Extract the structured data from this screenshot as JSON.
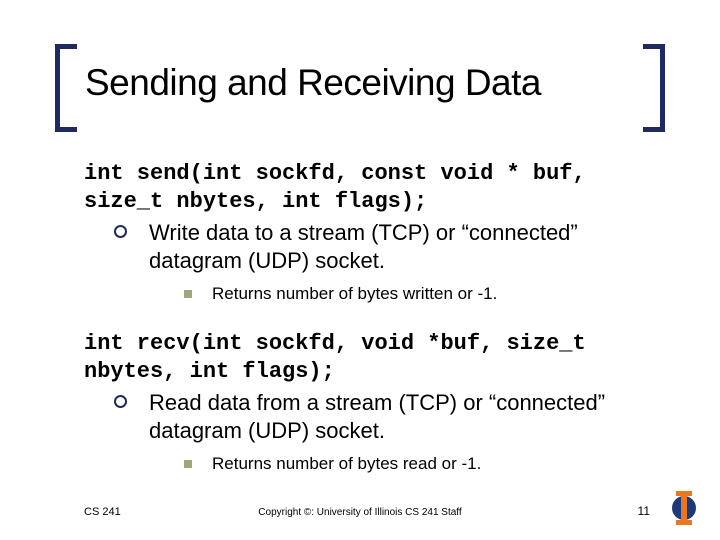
{
  "title": "Sending and Receiving Data",
  "send": {
    "signature": "int send(int sockfd, const void * buf, size_t nbytes, int flags);",
    "description": "Write data to a stream (TCP) or “connected” datagram (UDP) socket.",
    "returns": "Returns number of bytes written or -1."
  },
  "recv": {
    "signature": "int recv(int sockfd, void *buf, size_t nbytes, int flags);",
    "description": "Read data from a stream (TCP) or “connected” datagram (UDP) socket.",
    "returns": "Returns number of bytes read or -1."
  },
  "footer": {
    "left": "CS 241",
    "center": "Copyright ©: University of Illinois CS 241 Staff",
    "pagenum": "11"
  }
}
